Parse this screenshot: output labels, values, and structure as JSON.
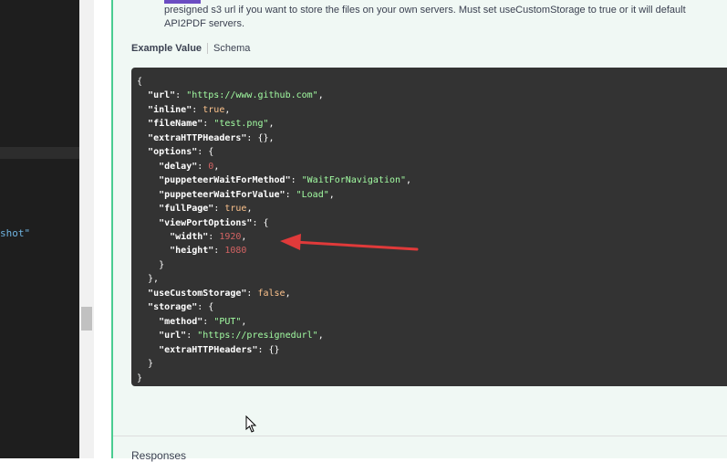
{
  "editor": {
    "fragment": "shot\""
  },
  "param": {
    "description": "presigned s3 url if you want to store the files on your own servers. Must set useCustomStorage to true or it will default API2PDF servers."
  },
  "tabs": {
    "example_value": "Example Value",
    "schema": "Schema"
  },
  "example_json": {
    "lines": [
      "{",
      "  \"url\": \"https://www.github.com\",",
      "  \"inline\": true,",
      "  \"fileName\": \"test.png\",",
      "  \"extraHTTPHeaders\": {},",
      "  \"options\": {",
      "    \"delay\": 0,",
      "    \"puppeteerWaitForMethod\": \"WaitForNavigation\",",
      "    \"puppeteerWaitForValue\": \"Load\",",
      "    \"fullPage\": true,",
      "    \"viewPortOptions\": {",
      "      \"width\": 1920,",
      "      \"height\": 1080",
      "    }",
      "  },",
      "  \"useCustomStorage\": false,",
      "  \"storage\": {",
      "    \"method\": \"PUT\",",
      "    \"url\": \"https://presignedurl\",",
      "    \"extraHTTPHeaders\": {}",
      "  }",
      "}"
    ]
  },
  "responses": {
    "heading": "Responses"
  },
  "colors": {
    "accent": "#49cc90",
    "annotation_arrow": "#e03a3a",
    "code_bg": "#333333"
  }
}
